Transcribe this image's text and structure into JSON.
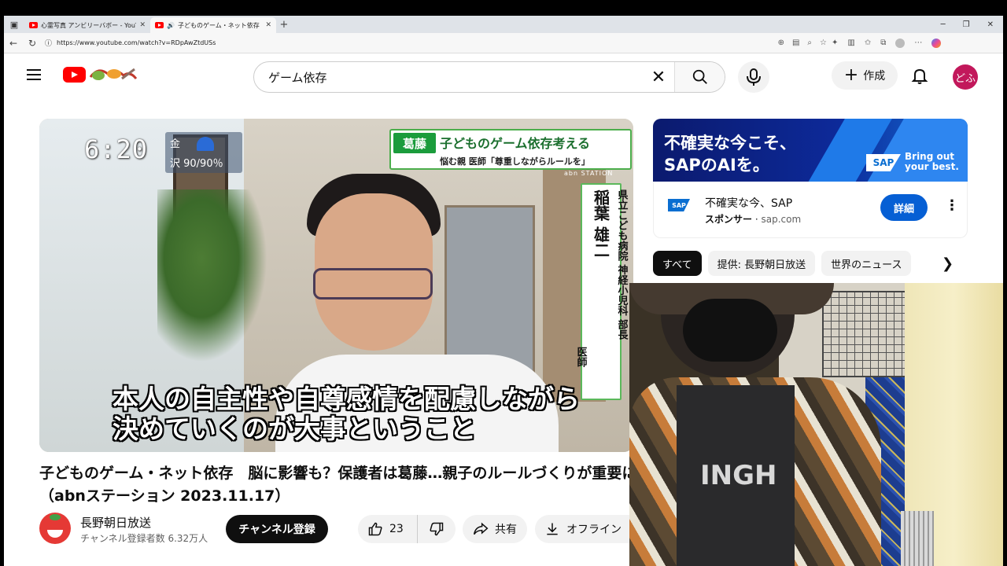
{
  "browser": {
    "tabs": [
      {
        "title": "心霊写真 アンビリーバボー - YouTube",
        "active": false
      },
      {
        "title": "子どものゲーム・ネット依存　脳に",
        "active": true
      }
    ],
    "url": "https://www.youtube.com/watch?v=RDpAwZtdUSs"
  },
  "masthead": {
    "search_query": "ゲーム依存",
    "create_label": "作成",
    "avatar_text": "どふ"
  },
  "video": {
    "overlay": {
      "clock": "6:20",
      "weather_day": "金",
      "weather_rain": "沢 90/90％",
      "headline_tag": "葛藤",
      "headline_title": "子どものゲーム依存考える",
      "headline_sub": "悩む親 医師「尊重しながらルールを」",
      "station": "abn STATION",
      "affiliation": "県立こども病院 神経小児科 部長",
      "doctor_name": "稲葉 雄二",
      "doctor_role": "医師",
      "caption_line1": "本人の自主性や自尊感情を配慮しながら",
      "caption_line2": "決めていくのが大事ということ"
    },
    "title": "子どものゲーム・ネット依存　脳に影響も？保護者は葛藤…親子のルールづくりが重要に（abnステーション 2023.11.17）",
    "channel_name": "長野朝日放送",
    "channel_subs": "チャンネル登録者数 6.32万人",
    "subscribe_label": "チャンネル登録",
    "like_count": "23",
    "share_label": "共有",
    "offline_label": "オフライン"
  },
  "ad": {
    "banner_headline_line1": "不確実な今こそ、",
    "banner_headline_line2": "SAPのAIを。",
    "banner_logo": "SAP",
    "banner_tagline_line1": "Bring out",
    "banner_tagline_line2": "your best.",
    "card_logo": "SAP",
    "card_title": "不確実な今、SAP",
    "card_sponsor": "スポンサー",
    "card_domain": "sap.com",
    "detail_label": "詳細"
  },
  "chips": [
    "すべて",
    "提供: 長野朝日放送",
    "世界のニュース"
  ],
  "webcam": {
    "shirt_text": "INGH"
  }
}
